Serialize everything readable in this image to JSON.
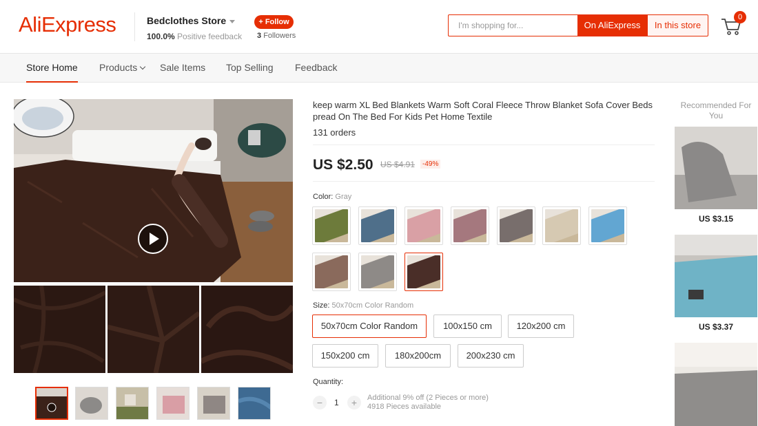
{
  "header": {
    "logo": "AliExpress",
    "store_name": "Bedclothes Store",
    "feedback_pct": "100.0%",
    "feedback_label": "Positive feedback",
    "follow_label": "+ Follow",
    "followers_count": "3",
    "followers_label": "Followers",
    "search_placeholder": "I'm shopping for...",
    "search_ali_label": "On AliExpress",
    "search_store_label": "In this store",
    "cart_count": "0"
  },
  "nav": {
    "items": [
      "Store Home",
      "Products",
      "Sale Items",
      "Top Selling",
      "Feedback"
    ],
    "active": "Store Home"
  },
  "product": {
    "title": "keep warm XL Bed Blankets Warm Soft Coral Fleece Throw Blanket Sofa Cover Beds pread On The Bed For Kids Pet Home Textile",
    "orders": "131 orders",
    "price": "US $2.50",
    "old_price": "US $4.91",
    "discount": "-49%",
    "color_label": "Color:",
    "color_value": "Gray",
    "colors": [
      {
        "hex": "#6d7b3b"
      },
      {
        "hex": "#4f6f8a"
      },
      {
        "hex": "#d9a0a5"
      },
      {
        "hex": "#a5787e"
      },
      {
        "hex": "#786e6c"
      },
      {
        "hex": "#d6c9b2"
      },
      {
        "hex": "#62a6d2"
      },
      {
        "hex": "#8a6a5c"
      },
      {
        "hex": "#8e8a87"
      },
      {
        "hex": "#4a2e28"
      }
    ],
    "size_label": "Size:",
    "size_value": "50x70cm Color Random",
    "sizes": [
      "50x70cm Color Random",
      "100x150 cm",
      "120x200 cm",
      "150x200 cm",
      "180x200cm",
      "200x230 cm"
    ],
    "quantity_label": "Quantity:",
    "quantity": "1",
    "qty_minus": "−",
    "qty_plus": "+",
    "discount_info": "Additional 9% off (2 Pieces or more)",
    "available": "4918 Pieces available"
  },
  "recommended": {
    "title": "Recommended For You",
    "items": [
      {
        "price": "US $3.15"
      },
      {
        "price": "US $3.37"
      }
    ]
  },
  "colors": {
    "accent": "#e62e04"
  }
}
